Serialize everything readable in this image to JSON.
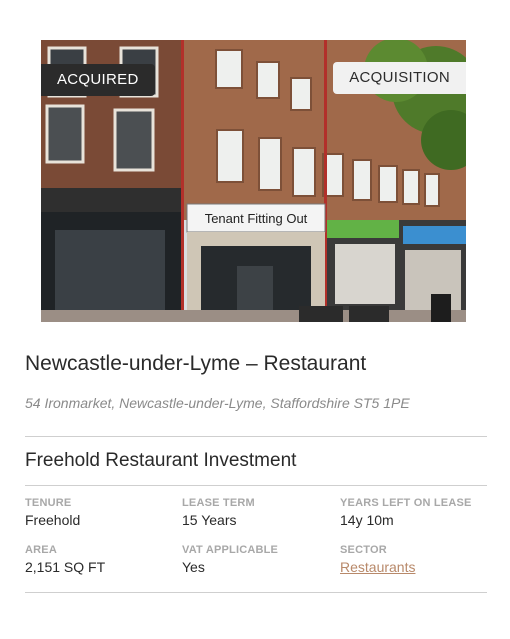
{
  "badges": {
    "left": "ACQUIRED",
    "right": "ACQUISITION"
  },
  "photo": {
    "description_alt": "Newcastle-under-Lyme – Restaurant",
    "shop_sign": "Tenant Fitting Out"
  },
  "property": {
    "title": "Newcastle-under-Lyme – Restaurant",
    "address": "54 Ironmarket, Newcastle-under-Lyme, Staffordshire ST5 1PE",
    "subtitle": "Freehold Restaurant Investment"
  },
  "specs": {
    "tenure": {
      "label": "TENURE",
      "value": "Freehold"
    },
    "lease_term": {
      "label": "LEASE TERM",
      "value": "15 Years"
    },
    "years_left": {
      "label": "YEARS LEFT ON LEASE",
      "value": "14y 10m"
    },
    "area": {
      "label": "AREA",
      "value": "2,151 SQ FT"
    },
    "vat": {
      "label": "VAT APPLICABLE",
      "value": "Yes"
    },
    "sector": {
      "label": "SECTOR",
      "value": "Restaurants"
    }
  },
  "colors": {
    "badge_dark": "#2b2b2b",
    "badge_light": "#f1f1f1",
    "link": "#b8896a",
    "divider": "#cfcfcf"
  }
}
